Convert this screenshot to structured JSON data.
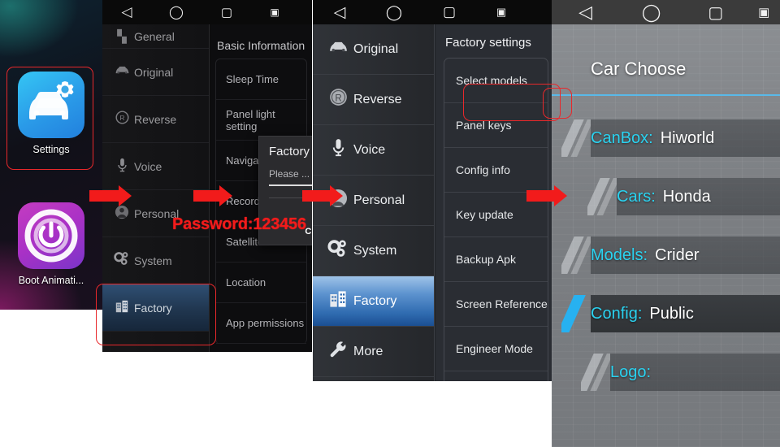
{
  "navbar": {
    "items": [
      {
        "name": "back-icon",
        "glyph": "◁"
      },
      {
        "name": "home-icon",
        "glyph": "◯"
      },
      {
        "name": "recents-icon",
        "glyph": "▢"
      },
      {
        "name": "screenshot-icon",
        "glyph": "▣"
      }
    ]
  },
  "panel1": {
    "apps": [
      {
        "label": "Settings",
        "icon": "car-settings-icon"
      },
      {
        "label": "Boot Animati...",
        "icon": "power-icon"
      }
    ]
  },
  "panel2": {
    "sidebar": [
      {
        "label": "General",
        "icon": "grid-icon",
        "glyph": "▚"
      },
      {
        "label": "Original",
        "icon": "car-icon",
        "glyph": "🚘"
      },
      {
        "label": "Reverse",
        "icon": "reverse-r-icon",
        "glyph": "Ⓡ"
      },
      {
        "label": "Voice",
        "icon": "microphone-icon",
        "glyph": "🎤"
      },
      {
        "label": "Personal",
        "icon": "person-icon",
        "glyph": "👤"
      },
      {
        "label": "System",
        "icon": "gears-icon",
        "glyph": "⚙"
      },
      {
        "label": "Factory",
        "icon": "building-icon",
        "glyph": "🏢",
        "selected": true
      }
    ],
    "content_title": "Basic Information",
    "items": [
      {
        "label": "Sleep Time"
      },
      {
        "label": "Panel light setting"
      },
      {
        "label": "Navigation"
      },
      {
        "label": "Record"
      },
      {
        "label": "Satellite info"
      },
      {
        "label": "Location"
      },
      {
        "label": "App permissions"
      }
    ],
    "dialog": {
      "title": "Factory",
      "hint": "Please ...",
      "button": "CANCEL"
    }
  },
  "panel3": {
    "sidebar": [
      {
        "label": "Original",
        "icon": "car-icon",
        "glyph": "🚘"
      },
      {
        "label": "Reverse",
        "icon": "reverse-r-icon",
        "glyph": "Ⓡ"
      },
      {
        "label": "Voice",
        "icon": "microphone-icon",
        "glyph": "🎤"
      },
      {
        "label": "Personal",
        "icon": "person-icon",
        "glyph": "👤"
      },
      {
        "label": "System",
        "icon": "gears-icon",
        "glyph": "⚙"
      },
      {
        "label": "Factory",
        "icon": "building-icon",
        "glyph": "🏢",
        "selected": true
      },
      {
        "label": "More",
        "icon": "wrench-icon",
        "glyph": "🔧"
      }
    ],
    "content_title": "Factory settings",
    "items": [
      {
        "label": "Select models",
        "highlighted": true
      },
      {
        "label": "Panel keys"
      },
      {
        "label": "Config info"
      },
      {
        "label": "Key update"
      },
      {
        "label": "Backup Apk"
      },
      {
        "label": "Screen Reference"
      },
      {
        "label": "Engineer Mode"
      }
    ]
  },
  "panel4": {
    "title": "Car Choose",
    "rows": [
      {
        "key": "CanBox:",
        "value": "Hiworld"
      },
      {
        "key": "Cars:",
        "value": "Honda"
      },
      {
        "key": "Models:",
        "value": "Crider"
      },
      {
        "key": "Config:",
        "value": "Public",
        "active": true
      },
      {
        "key": "Logo:",
        "value": ""
      }
    ]
  },
  "annotations": {
    "password_note": "Password:123456"
  },
  "colors": {
    "accent_cyan": "#2ad2f0",
    "rule_blue": "#59b9e8",
    "annotation_red": "#f21b1b",
    "selected_blue": "#2f6bb0"
  }
}
